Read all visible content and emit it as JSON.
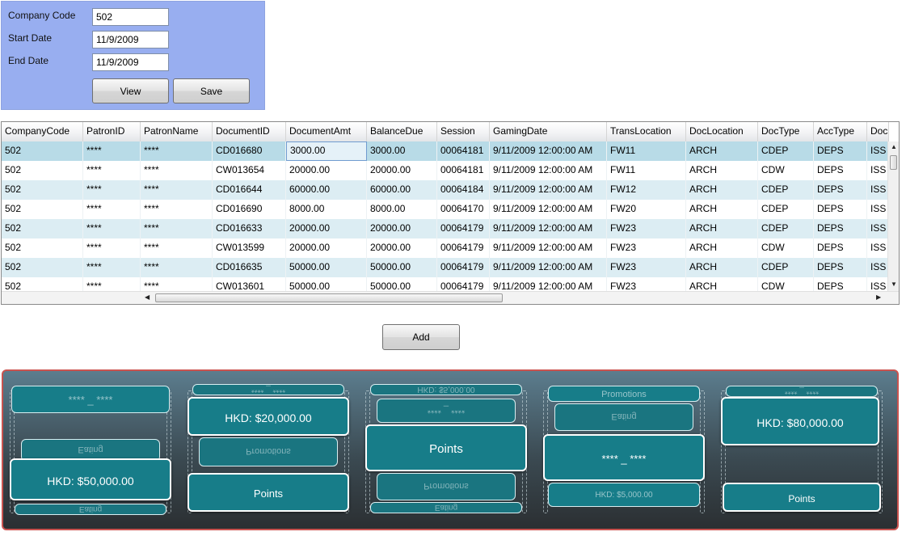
{
  "form": {
    "company_code_label": "Company Code",
    "company_code_value": "502",
    "start_date_label": "Start Date",
    "start_date_value": "11/9/2009",
    "end_date_label": "End Date",
    "end_date_value": "11/9/2009",
    "view_label": "View",
    "save_label": "Save"
  },
  "grid": {
    "columns": [
      "CompanyCode",
      "PatronID",
      "PatronName",
      "DocumentID",
      "DocumentAmt",
      "BalanceDue",
      "Session",
      "GamingDate",
      "TransLocation",
      "DocLocation",
      "DocType",
      "AccType",
      "Doc"
    ],
    "rows": [
      [
        "502",
        "****",
        "****",
        "CD016680",
        "3000.00",
        "3000.00",
        "00064181",
        "9/11/2009 12:00:00 AM",
        "FW11",
        "ARCH",
        "CDEP",
        "DEPS",
        "ISS"
      ],
      [
        "502",
        "****",
        "****",
        "CW013654",
        "20000.00",
        "20000.00",
        "00064181",
        "9/11/2009 12:00:00 AM",
        "FW11",
        "ARCH",
        "CDW",
        "DEPS",
        "ISS"
      ],
      [
        "502",
        "****",
        "****",
        "CD016644",
        "60000.00",
        "60000.00",
        "00064184",
        "9/11/2009 12:00:00 AM",
        "FW12",
        "ARCH",
        "CDEP",
        "DEPS",
        "ISS"
      ],
      [
        "502",
        "****",
        "****",
        "CD016690",
        "8000.00",
        "8000.00",
        "00064170",
        "9/11/2009 12:00:00 AM",
        "FW20",
        "ARCH",
        "CDEP",
        "DEPS",
        "ISS"
      ],
      [
        "502",
        "****",
        "****",
        "CD016633",
        "20000.00",
        "20000.00",
        "00064179",
        "9/11/2009 12:00:00 AM",
        "FW23",
        "ARCH",
        "CDEP",
        "DEPS",
        "ISS"
      ],
      [
        "502",
        "****",
        "****",
        "CW013599",
        "20000.00",
        "20000.00",
        "00064179",
        "9/11/2009 12:00:00 AM",
        "FW23",
        "ARCH",
        "CDW",
        "DEPS",
        "ISS"
      ],
      [
        "502",
        "****",
        "****",
        "CD016635",
        "50000.00",
        "50000.00",
        "00064179",
        "9/11/2009 12:00:00 AM",
        "FW23",
        "ARCH",
        "CDEP",
        "DEPS",
        "ISS"
      ],
      [
        "502",
        "****",
        "****",
        "CW013601",
        "50000.00",
        "50000.00",
        "00064179",
        "9/11/2009 12:00:00 AM",
        "FW23",
        "ARCH",
        "CDW",
        "DEPS",
        "ISS"
      ]
    ]
  },
  "add_label": "Add",
  "carousel": {
    "columns": [
      {
        "cards": [
          {
            "text": "**** _ ****",
            "kind": "front-soft",
            "size": 13
          },
          {
            "text": "Eating",
            "kind": "back",
            "size": 11
          },
          {
            "text": "HKD: $50,000.00",
            "kind": "front",
            "size": 14
          },
          {
            "text": "Eating",
            "kind": "back",
            "size": 10
          }
        ]
      },
      {
        "cards": [
          {
            "text": "**** _ ****",
            "kind": "back",
            "size": 10
          },
          {
            "text": "HKD: $20,000.00",
            "kind": "front",
            "size": 14
          },
          {
            "text": "Promotions",
            "kind": "back",
            "size": 11
          },
          {
            "text": "Points",
            "kind": "front",
            "size": 13
          }
        ]
      },
      {
        "cards": [
          {
            "text": "HKD: $5,000.00",
            "kind": "back",
            "size": 10
          },
          {
            "text": "**** _ ****",
            "kind": "back",
            "size": 11
          },
          {
            "text": "Points",
            "kind": "front",
            "size": 15
          },
          {
            "text": "Promotions",
            "kind": "back",
            "size": 11
          },
          {
            "text": "Eating",
            "kind": "back",
            "size": 10
          }
        ]
      },
      {
        "cards": [
          {
            "text": "Promotions",
            "kind": "front-soft",
            "size": 11
          },
          {
            "text": "Eating",
            "kind": "back",
            "size": 11
          },
          {
            "text": "**** _ ****",
            "kind": "front",
            "size": 13
          },
          {
            "text": "HKD: $5,000.00",
            "kind": "front-soft",
            "size": 10
          }
        ]
      },
      {
        "cards": [
          {
            "text": "**** _ ****",
            "kind": "back",
            "size": 10
          },
          {
            "text": "HKD: $80,000.00",
            "kind": "front",
            "size": 14
          },
          {
            "text": "Points",
            "kind": "front",
            "size": 12
          }
        ]
      }
    ]
  }
}
